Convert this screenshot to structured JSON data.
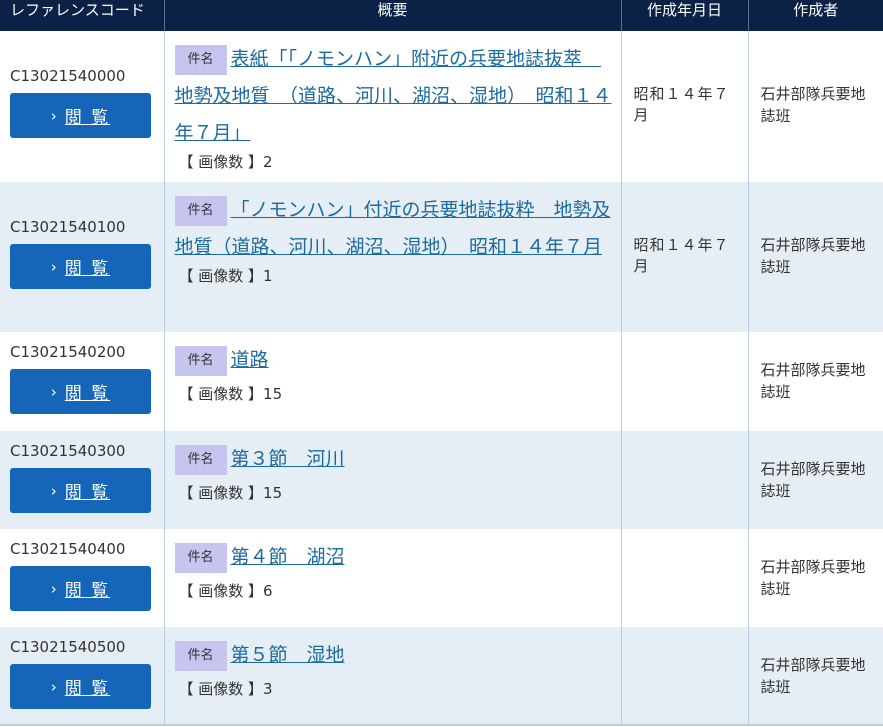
{
  "headers": {
    "ref_code": "レファレンスコード",
    "summary": "概要",
    "date": "作成年月日",
    "author": "作成者"
  },
  "labels": {
    "view_chevron": "›",
    "view": "閲 覧",
    "kenmei": "件名"
  },
  "rows": [
    {
      "code": "C13021540000",
      "title": "表紙「「ノモンハン」附近の兵要地誌抜萃　地勢及地質　（道路、河川、湖沼、湿地）　昭和１４年７月」",
      "pages": "【 画像数 】2",
      "date": "昭和１４年７月",
      "author": "石井部隊兵要地誌班"
    },
    {
      "code": "C13021540100",
      "title": "「ノモンハン」付近の兵要地誌抜粋　地勢及地質（道路、河川、湖沼、湿地）　昭和１４年７月",
      "pages": "【 画像数 】1",
      "date": "昭和１４年７月",
      "author": "石井部隊兵要地誌班"
    },
    {
      "code": "C13021540200",
      "title": "道路",
      "pages": "【 画像数 】15",
      "date": "",
      "author": "石井部隊兵要地誌班"
    },
    {
      "code": "C13021540300",
      "title": "第３節　河川",
      "pages": "【 画像数 】15",
      "date": "",
      "author": "石井部隊兵要地誌班"
    },
    {
      "code": "C13021540400",
      "title": "第４節　湖沼",
      "pages": "【 画像数 】6",
      "date": "",
      "author": "石井部隊兵要地誌班"
    },
    {
      "code": "C13021540500",
      "title": "第５節　湿地",
      "pages": "【 画像数 】3",
      "date": "",
      "author": "石井部隊兵要地誌班"
    }
  ]
}
